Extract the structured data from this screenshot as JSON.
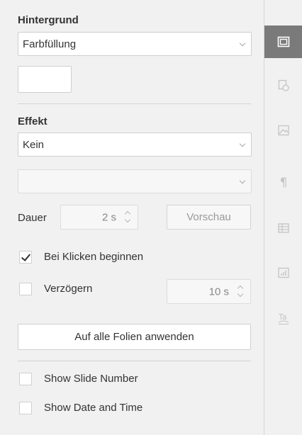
{
  "background": {
    "heading": "Hintergrund",
    "fill_select": "Farbfüllung"
  },
  "effect": {
    "heading": "Effekt",
    "effect_select": "Kein",
    "sub_select": "",
    "duration_label": "Dauer",
    "duration_value": "2 s",
    "preview_button": "Vorschau",
    "start_on_click": {
      "label": "Bei Klicken beginnen",
      "checked": true
    },
    "delay": {
      "label": "Verzögern",
      "checked": false,
      "value": "10 s"
    },
    "apply_all_button": "Auf alle Folien anwenden"
  },
  "footer_options": {
    "slide_number": {
      "label": "Show Slide Number",
      "checked": false
    },
    "date_time": {
      "label": "Show Date and Time",
      "checked": false
    }
  },
  "rail": {
    "items": [
      {
        "icon": "slide-settings-icon",
        "active": true
      },
      {
        "icon": "shape-settings-icon",
        "active": false
      },
      {
        "icon": "image-settings-icon",
        "active": false
      },
      {
        "icon": "paragraph-settings-icon",
        "active": false
      },
      {
        "icon": "table-settings-icon",
        "active": false
      },
      {
        "icon": "chart-settings-icon",
        "active": false
      },
      {
        "icon": "text-art-settings-icon",
        "active": false
      }
    ]
  },
  "colors": {
    "rail_active_bg": "#7a7a7a",
    "panel_bg": "#f1f1f1"
  }
}
